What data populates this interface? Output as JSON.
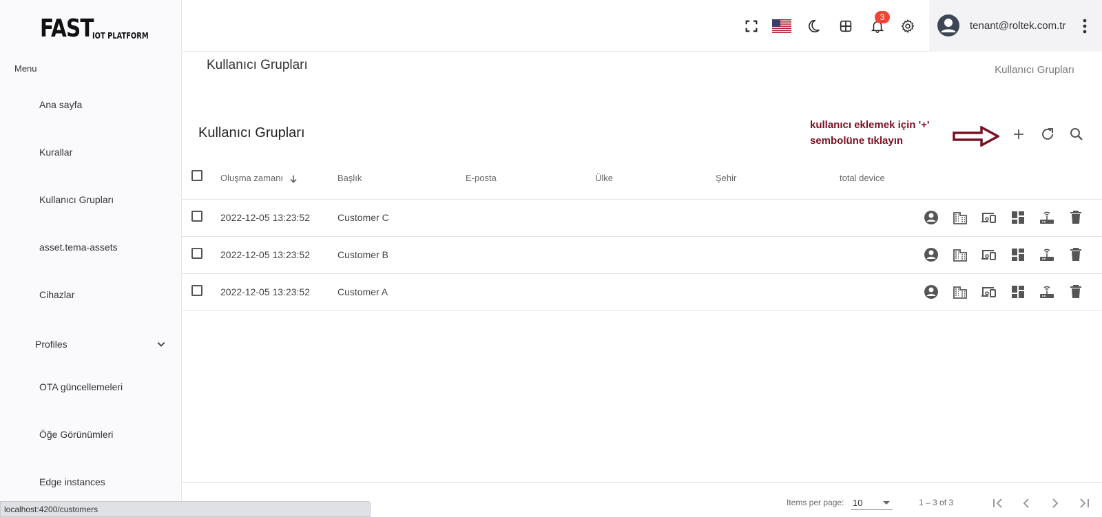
{
  "logo": {
    "main": "FAST",
    "sub": "IOT PLATFORM"
  },
  "sidebar": {
    "caption": "Menu",
    "items": [
      {
        "label": "Ana sayfa"
      },
      {
        "label": "Kurallar"
      },
      {
        "label": "Kullanıcı Grupları"
      },
      {
        "label": "asset.tema-assets"
      },
      {
        "label": "Cihazlar"
      },
      {
        "label": "Profiles"
      },
      {
        "label": "OTA güncellemeleri"
      },
      {
        "label": "Öğe Görünümleri"
      },
      {
        "label": "Edge instances"
      }
    ]
  },
  "header": {
    "notification_count": "3",
    "user_email": "tenant@roltek.com.tr",
    "icons": [
      "fullscreen-icon",
      "us-flag-icon",
      "moon-icon",
      "apps-grid-icon",
      "bell-icon",
      "gear-icon",
      "account-circle-icon",
      "more-vert-icon"
    ]
  },
  "page": {
    "title": "Kullanıcı Grupları",
    "breadcrumb": "Kullanıcı Grupları"
  },
  "card": {
    "title": "Kullanıcı Grupları",
    "annotation_line1": "kullanıcı eklemek için '+'",
    "annotation_line2": "sembolüne tıklayın"
  },
  "table": {
    "columns": [
      "Oluşma zamanı",
      "Başlık",
      "E-posta",
      "Ülke",
      "Şehir",
      "total device"
    ],
    "rows": [
      {
        "created": "2022-12-05 13:23:52",
        "title": "Customer C"
      },
      {
        "created": "2022-12-05 13:23:52",
        "title": "Customer B"
      },
      {
        "created": "2022-12-05 13:23:52",
        "title": "Customer A"
      }
    ],
    "row_actions": [
      "account-icon",
      "building-icon",
      "devices-icon",
      "dashboard-icon",
      "router-icon",
      "delete-icon"
    ]
  },
  "paginator": {
    "items_per_page_label": "Items per page:",
    "page_size": "10",
    "range": "1 – 3 of 3"
  },
  "statusbar": {
    "url": "localhost:4200/customers"
  },
  "colors": {
    "annotation": "#7a1020",
    "badge": "#f44336",
    "icon": "#555555"
  }
}
